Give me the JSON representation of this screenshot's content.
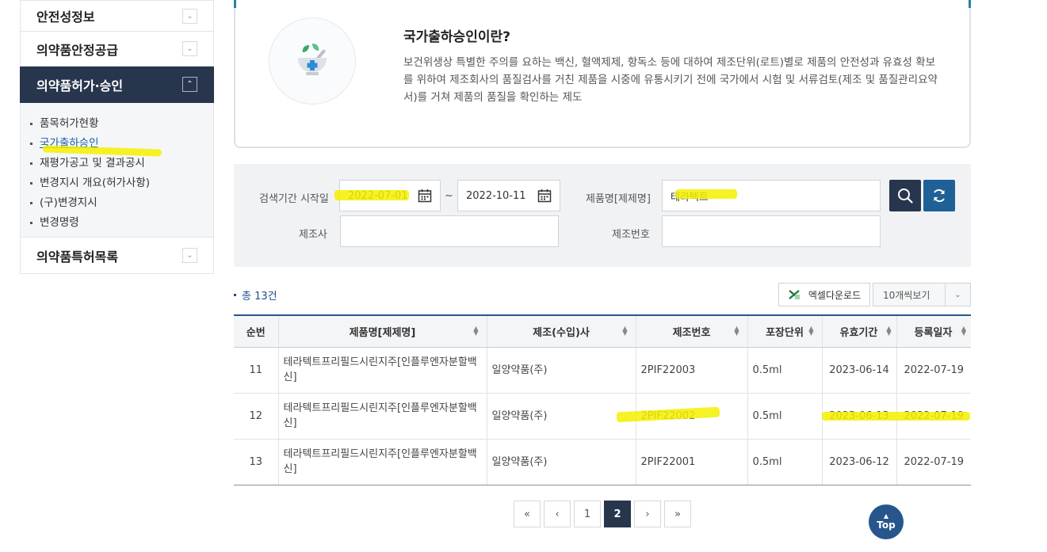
{
  "sidebar": {
    "items": [
      {
        "label": "안전성정보"
      },
      {
        "label": "의약품안정공급"
      },
      {
        "label": "의약품허가·승인"
      },
      {
        "label": "의약품특허목록"
      }
    ],
    "submenu": [
      {
        "label": "품목허가현황"
      },
      {
        "label": "국가출하승인"
      },
      {
        "label": "재평가공고 및 결과공시"
      },
      {
        "label": "변경지시 개요(허가사항)"
      },
      {
        "label": "(구)변경지시"
      },
      {
        "label": "변경명령"
      }
    ]
  },
  "info": {
    "title": "국가출하승인이란?",
    "description": "보건위생상 특별한 주의를 요하는 백신, 혈액제제, 항독소 등에 대하여 제조단위(로트)별로 제품의 안전성과 유효성 확보를 위하여 제조회사의 품질검사를 거친 제품을 시중에 유통시키기 전에 국가에서 시험 및 서류검토(제조 및 품질관리요약서)를 거쳐 제품의 품질을 확인하는 제도",
    "icon": "mortar-pestle-icon"
  },
  "search": {
    "start_label": "검색기간 시작일",
    "start_value": "2022-07-01",
    "tilde": "~",
    "end_value": "2022-10-11",
    "product_label": "제품명[제제명]",
    "product_value": "테라텍트",
    "maker_label": "제조사",
    "maker_value": "",
    "lot_label": "제조번호",
    "lot_value": ""
  },
  "results": {
    "total": "총 13건",
    "excel_label": "엑셀다운로드",
    "view_label": "10개씩보기"
  },
  "table": {
    "headers": [
      "순번",
      "제품명[제제명]",
      "제조(수입)사",
      "제조번호",
      "포장단위",
      "유효기간",
      "등록일자"
    ],
    "rows": [
      [
        "11",
        "테라텍트프리필드시린지주[인플루엔자분할백신]",
        "일양약품(주)",
        "2PIF22003",
        "0.5ml",
        "2023-06-14",
        "2022-07-19"
      ],
      [
        "12",
        "테라텍트프리필드시린지주[인플루엔자분할백신]",
        "일양약품(주)",
        "2PIF22002",
        "0.5ml",
        "2023-06-13",
        "2022-07-19"
      ],
      [
        "13",
        "테라텍트프리필드시린지주[인플루엔자분할백신]",
        "일양약품(주)",
        "2PIF22001",
        "0.5ml",
        "2023-06-12",
        "2022-07-19"
      ]
    ]
  },
  "pager": {
    "first": "«",
    "prev": "‹",
    "pages": [
      "1",
      "2"
    ],
    "current": "2",
    "next": "›",
    "last": "»"
  },
  "top_label": "Top",
  "colors": {
    "navy": "#27364d",
    "accent_blue": "#27568c",
    "highlight": "#f5f000"
  }
}
